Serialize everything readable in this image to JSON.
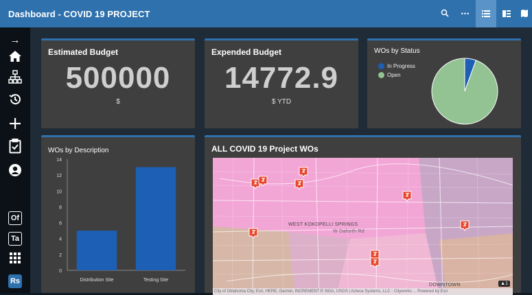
{
  "header": {
    "title": "Dashboard - COVID 19 PROJECT",
    "buttons": [
      {
        "name": "search-icon",
        "glyph": "🔍"
      },
      {
        "name": "more-icon",
        "glyph": "•••"
      },
      {
        "name": "list-view-icon",
        "glyph": "☰"
      },
      {
        "name": "split-view-icon",
        "glyph": "▥"
      },
      {
        "name": "map-view-icon",
        "glyph": "◧"
      }
    ]
  },
  "sidebar": {
    "items": [
      {
        "name": "expand-arrow-icon",
        "glyph": "→"
      },
      {
        "name": "home-icon",
        "glyph": "⌂"
      },
      {
        "name": "hierarchy-icon",
        "glyph": "品"
      },
      {
        "name": "history-icon",
        "glyph": "↺"
      },
      {
        "name": "add-icon",
        "glyph": "+"
      },
      {
        "name": "clipboard-check-icon",
        "glyph": "☑"
      },
      {
        "name": "user-icon",
        "glyph": "●"
      }
    ],
    "badges": [
      "Of",
      "Ta",
      "Rs"
    ],
    "grid_icon": "⠿"
  },
  "cards": {
    "estimated_budget": {
      "title": "Estimated Budget",
      "value": "500000",
      "unit": "$"
    },
    "expended_budget": {
      "title": "Expended Budget",
      "value": "14772.9",
      "unit": "$ YTD"
    },
    "wos_by_status": {
      "title": "WOs by Status"
    },
    "wos_by_description": {
      "title": "WOs by Description"
    },
    "map": {
      "title": "ALL COVID 19 Project WOs",
      "labels": {
        "street1": "WEST KOKOPELLI SPRINGS",
        "street2": "W Daforth Rd",
        "downtown": "DOWNTOWN"
      },
      "attribution": "City of Oklahoma City, Esri, HERE, Garmin, INCREMENT P, NGA, USGS | Azteca Systems, LLC - Cityworks ...     Powered by Esri",
      "cluster_badge": "▲1"
    }
  },
  "colors": {
    "accent": "#2f71ad",
    "in_progress": "#1d5fb4",
    "open": "#93c393",
    "bar": "#1d5fb4"
  },
  "chart_data": [
    {
      "type": "pie",
      "title": "WOs by Status",
      "series": [
        {
          "name": "In Progress",
          "value": 1
        },
        {
          "name": "Open",
          "value": 17
        }
      ]
    },
    {
      "type": "bar",
      "title": "WOs by Description",
      "categories": [
        "Distribution Site",
        "Testing Site"
      ],
      "values": [
        5,
        13
      ],
      "ylim": [
        0,
        14
      ],
      "yticks": [
        0,
        2,
        4,
        6,
        8,
        10,
        12,
        14
      ],
      "grid": false
    }
  ]
}
